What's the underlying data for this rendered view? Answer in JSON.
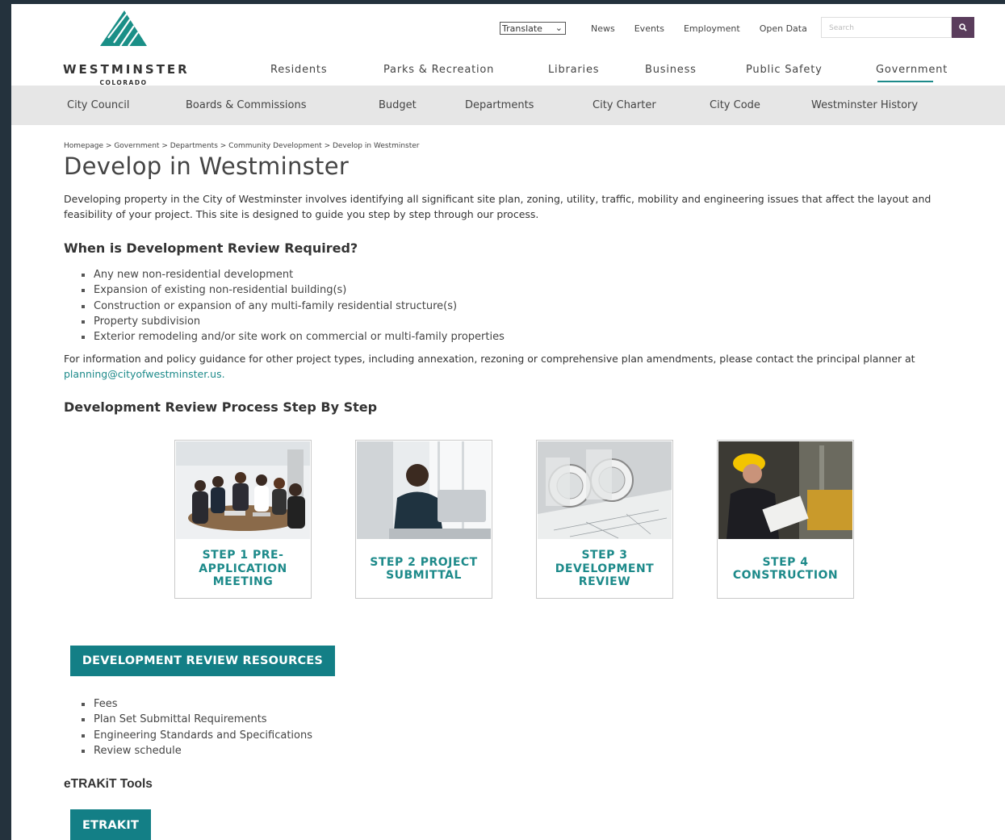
{
  "brand": {
    "name": "WESTMINSTER",
    "sub": "COLORADO"
  },
  "utility": {
    "translate": "Translate",
    "links": [
      "News",
      "Events",
      "Employment",
      "Open Data"
    ],
    "search_placeholder": "Search"
  },
  "main_nav": [
    "Residents",
    "Parks & Recreation",
    "Libraries",
    "Business",
    "Public Safety",
    "Government"
  ],
  "sub_nav": [
    "City Council",
    "Boards & Commissions",
    "Budget",
    "Departments",
    "City Charter",
    "City Code",
    "Westminster History"
  ],
  "breadcrumb": [
    "Homepage",
    "Government",
    "Departments",
    "Community Development",
    "Develop in Westminster"
  ],
  "page": {
    "title": "Develop in Westminster",
    "intro": "Developing property in the City of Westminster involves identifying all significant site plan, zoning, utility, traffic, mobility and engineering issues that affect the layout and feasibility of your project. This site is designed to guide you step by step through our process.",
    "review_heading": "When is Development Review Required?",
    "review_items": [
      "Any new non-residential development",
      "Expansion of existing non-residential building(s)",
      "Construction or expansion of any multi-family residential structure(s)",
      "Property subdivision",
      "Exterior remodeling and/or site work on commercial or multi-family properties"
    ],
    "info_text": "For information and policy guidance for other project types, including annexation, rezoning or comprehensive plan amendments, please contact the principal planner at",
    "info_email": "planning@cityofwestminster.us.",
    "process_heading": "Development Review Process Step By Step",
    "steps": [
      "STEP 1 PRE-APPLICATION MEETING",
      "STEP 2 PROJECT SUBMITTAL",
      "STEP 3 DEVELOPMENT REVIEW",
      "STEP 4 CONSTRUCTION"
    ],
    "resources_button": "DEVELOPMENT REVIEW RESOURCES",
    "resources": [
      "Fees",
      "Plan Set Submittal Requirements",
      "Engineering Standards and Specifications",
      "Review schedule"
    ],
    "tools_heading": "eTRAKiT Tools",
    "etrakit_button": "ETRAKIT"
  },
  "colors": {
    "accent": "#1d8a8a",
    "button": "#137f86",
    "search_button": "#5a3d5c",
    "subnav_bg": "#e6e6e6"
  }
}
